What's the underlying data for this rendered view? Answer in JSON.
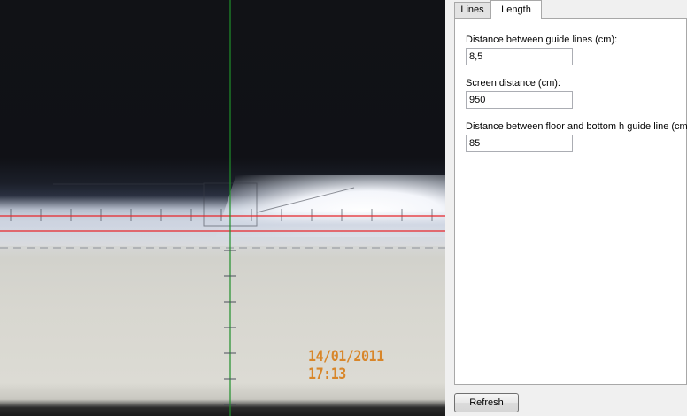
{
  "camera": {
    "timestamp": "14/01/2011  17:13",
    "guide_line_color": "#e8262a",
    "vertical_line_color": "#1f8f2a"
  },
  "tabs": [
    {
      "label": "Lines",
      "selected": false
    },
    {
      "label": "Length",
      "selected": true
    }
  ],
  "fields": {
    "guide_lines_distance": {
      "label": "Distance between guide lines (cm):",
      "value": "8,5"
    },
    "screen_distance": {
      "label": "Screen distance (cm):",
      "value": "950"
    },
    "floor_distance": {
      "label": "Distance between floor and bottom h guide line (cm):",
      "value": "85"
    }
  },
  "buttons": {
    "refresh": "Refresh"
  }
}
